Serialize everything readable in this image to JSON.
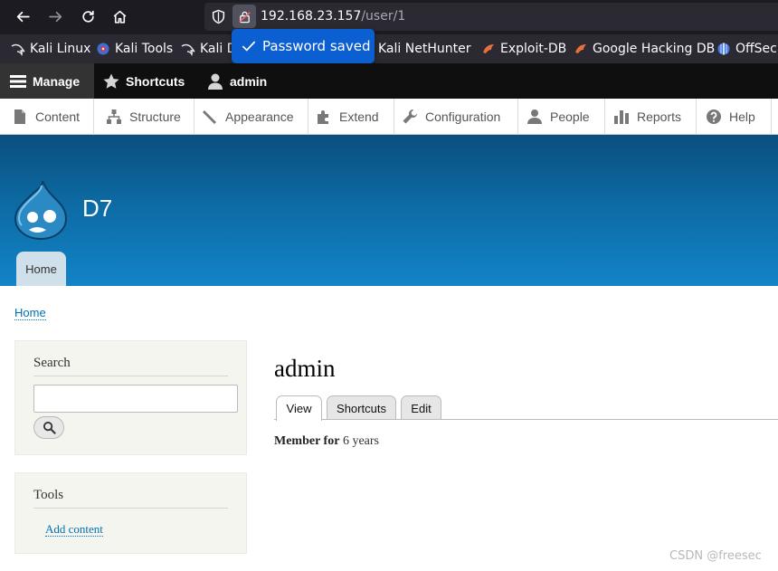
{
  "browser": {
    "url_host": "192.168.23.157",
    "url_path": "/user/1",
    "password_popup": "Password saved",
    "bookmarks": [
      {
        "label": "Kali Linux",
        "icon": "kali-dragon-icon"
      },
      {
        "label": "Kali Tools",
        "icon": "kali-tools-icon"
      },
      {
        "label": "Kali D",
        "icon": "kali-dragon-icon"
      },
      {
        "label": "Kali NetHunter",
        "icon": "kali-dragon-icon"
      },
      {
        "label": "Exploit-DB",
        "icon": "exploit-db-icon"
      },
      {
        "label": "Google Hacking DB",
        "icon": "exploit-db-icon"
      },
      {
        "label": "OffSec",
        "icon": "offsec-icon"
      }
    ]
  },
  "admin_toolbar": {
    "manage": "Manage",
    "shortcuts": "Shortcuts",
    "user": "admin"
  },
  "admin_tray": [
    {
      "label": "Content",
      "icon": "file-icon"
    },
    {
      "label": "Structure",
      "icon": "sitemap-icon"
    },
    {
      "label": "Appearance",
      "icon": "paintbrush-icon"
    },
    {
      "label": "Extend",
      "icon": "puzzle-icon"
    },
    {
      "label": "Configuration",
      "icon": "wrench-icon"
    },
    {
      "label": "People",
      "icon": "person-icon"
    },
    {
      "label": "Reports",
      "icon": "bar-chart-icon"
    },
    {
      "label": "Help",
      "icon": "help-icon"
    }
  ],
  "site": {
    "name": "D7",
    "home_tab": "Home"
  },
  "breadcrumb": "Home",
  "sidebar": {
    "search_title": "Search",
    "search_value": "",
    "tools_title": "Tools",
    "tools_link": "Add content"
  },
  "main": {
    "title": "admin",
    "tabs": [
      "View",
      "Shortcuts",
      "Edit"
    ],
    "member_label": "Member for",
    "member_value": "6 years"
  },
  "watermark": "CSDN @freesec",
  "colors": {
    "header_dark": "#0a4f80",
    "header_light": "#1284c8",
    "link": "#0071b3",
    "popup_blue": "#0b5fd1"
  }
}
